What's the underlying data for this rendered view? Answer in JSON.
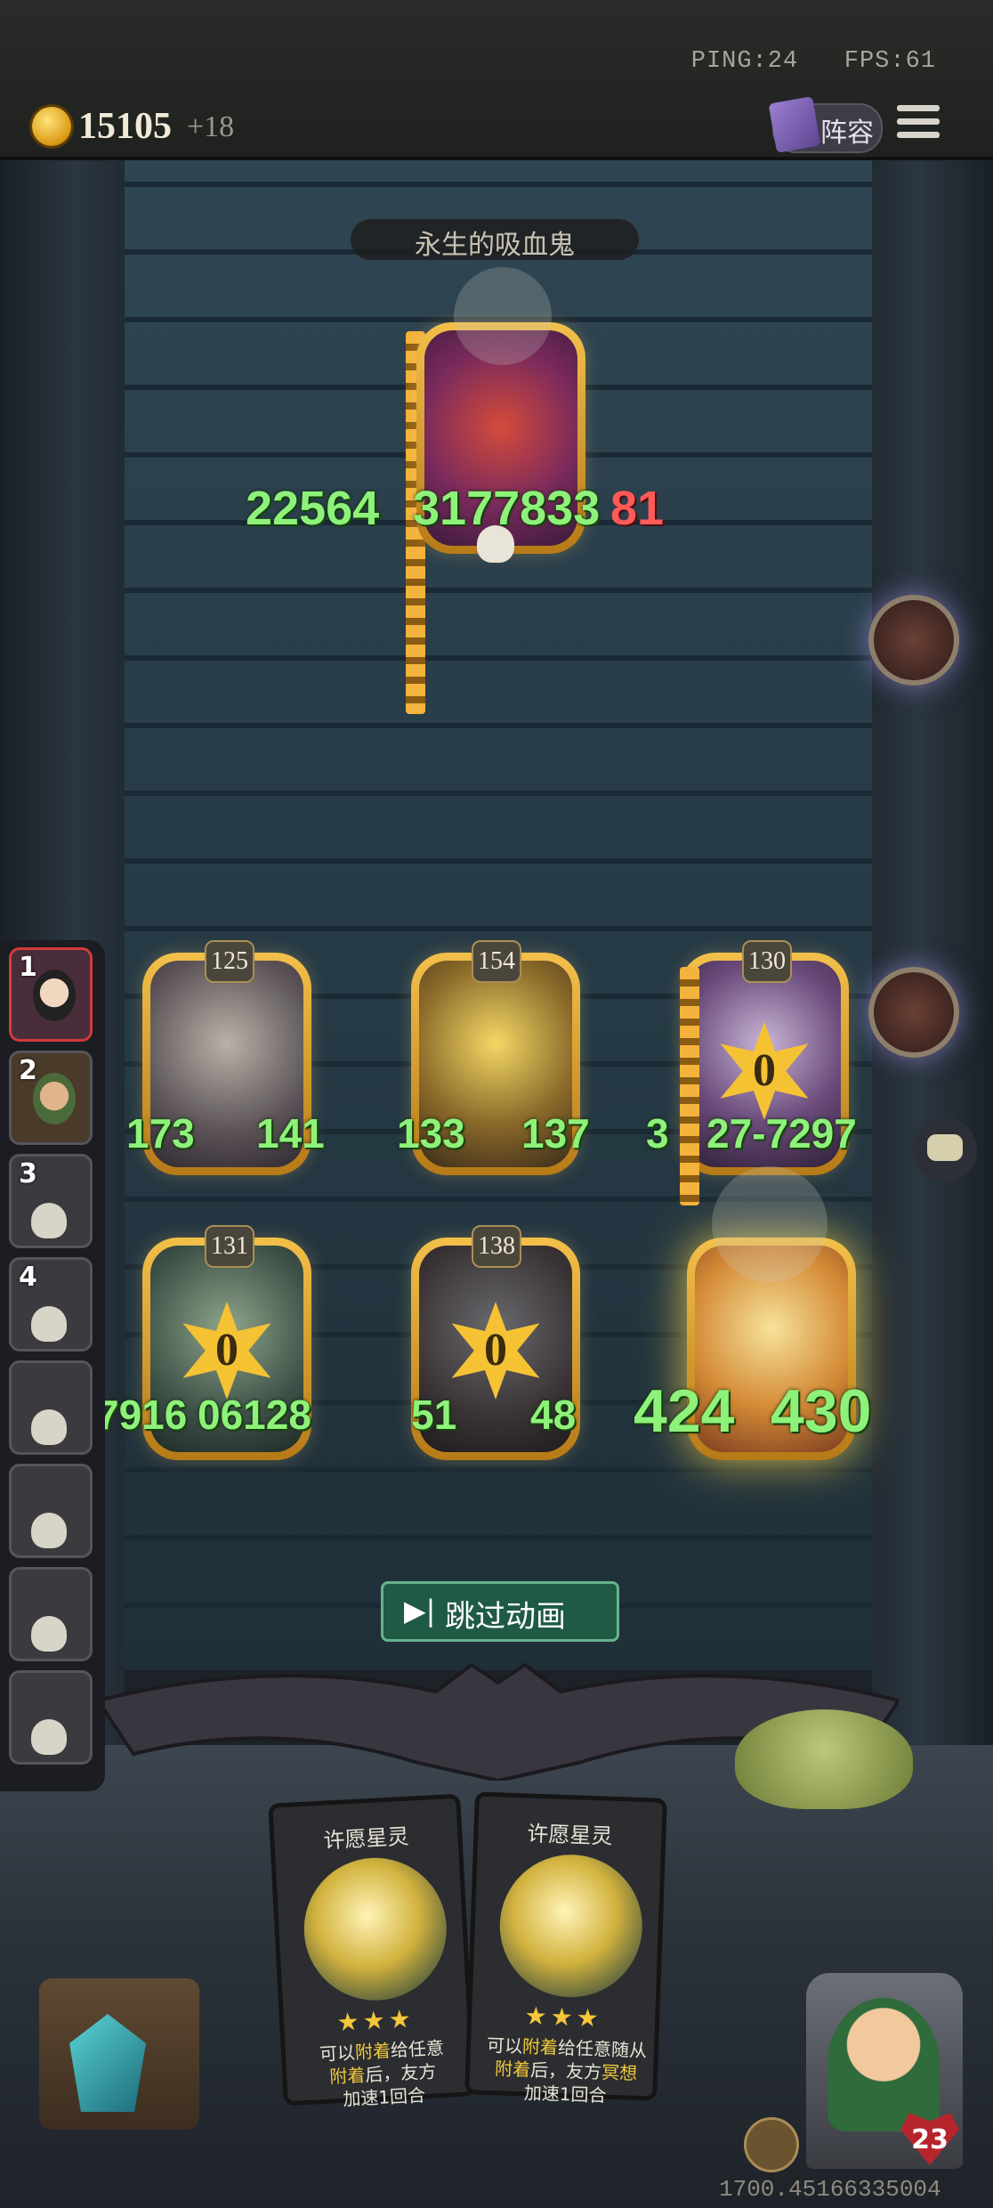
{
  "status": {
    "ping": "PING:24",
    "fps": "FPS:61"
  },
  "currency": {
    "coins": "15105",
    "bonus": "+18"
  },
  "toolbar": {
    "lineup_label": "阵容"
  },
  "boss": {
    "name": "永生的吸血鬼",
    "attack": "22564",
    "mid": "3177833",
    "health": "81"
  },
  "board": {
    "row1": [
      {
        "level": "125",
        "attack": "173",
        "health": "141"
      },
      {
        "level": "154",
        "attack": "133",
        "health": "137"
      },
      {
        "level": "130",
        "attack": "3",
        "health": "27-7297",
        "star": "0"
      }
    ],
    "row2": [
      {
        "level": "131",
        "attack": "7916",
        "health": "06128",
        "star": "0"
      },
      {
        "level": "138",
        "attack": "51",
        "health": "48",
        "star": "0"
      },
      {
        "attack": "424",
        "health": "430"
      }
    ]
  },
  "roster": [
    "1",
    "2",
    "3",
    "4"
  ],
  "skip": {
    "label": "跳过动画",
    "icon": "▶|"
  },
  "hand": [
    {
      "title": "许愿星灵",
      "stars": "★★★",
      "desc_a": "可以",
      "desc_hl": "附着",
      "desc_b": "给任意",
      "desc_c": "附着",
      "desc_d": "后，友方",
      "desc_e": "加速1回合"
    },
    {
      "title": "许愿星灵",
      "stars": "★★★",
      "desc_a": "可以",
      "desc_hl": "附着",
      "desc_b": "给任意随从",
      "desc_c": "附着",
      "desc_d": "后，友方",
      "desc_hl2": "冥想",
      "desc_e": "加速1回合"
    }
  ],
  "hero": {
    "health": "23"
  },
  "debug": {
    "coords": "1700.45166335004"
  },
  "colors": {
    "accent_green": "#8ef27a",
    "damage_red": "#ff5a5a",
    "gold": "#f3c04a"
  }
}
